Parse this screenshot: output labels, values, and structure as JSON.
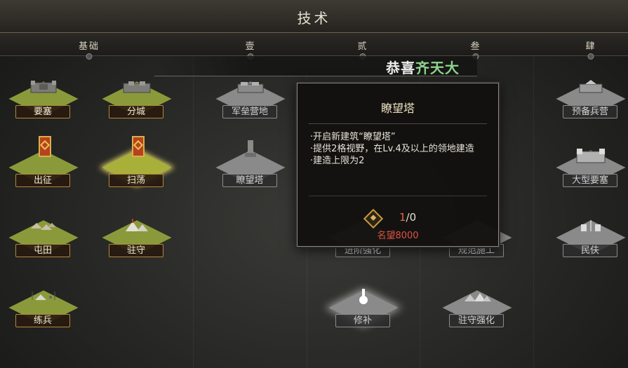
{
  "title": "技术",
  "tiers": [
    "基础",
    "壹",
    "贰",
    "叁",
    "肆"
  ],
  "banner": {
    "prefix": "恭喜",
    "highlight": "齐天大"
  },
  "nodes": {
    "yaosai": "要塞",
    "fencheng": "分城",
    "chuzheng": "出征",
    "saodang": "扫荡",
    "tuntian": "屯田",
    "zhushou": "驻守",
    "lianbing": "练兵",
    "junleiyingdi": "军垒营地",
    "liaowangta": "瞭望塔",
    "jinjieqianghua": "进阶强化",
    "guifanshigong": "规范施工",
    "xiubu": "修补",
    "zhushouqianghua": "驻守强化",
    "yubeibingying": "预备兵营",
    "daxingyaosai": "大型要塞",
    "minfu": "民伕"
  },
  "tooltip": {
    "title": "瞭望塔",
    "desc": [
      "·开启新建筑“瞭望塔”",
      "·提供2格视野，在Lv.4及以上的领地建造",
      "·建造上限为2"
    ],
    "progress_current": "1",
    "progress_sep": "/",
    "progress_max": "0",
    "requirement": "名望8000"
  },
  "colors": {
    "unlocked_ground": "#8a9a3a",
    "locked_ground": "#8a8a8a",
    "requirement": "#e0533f",
    "highlight": "#8fd48e"
  }
}
